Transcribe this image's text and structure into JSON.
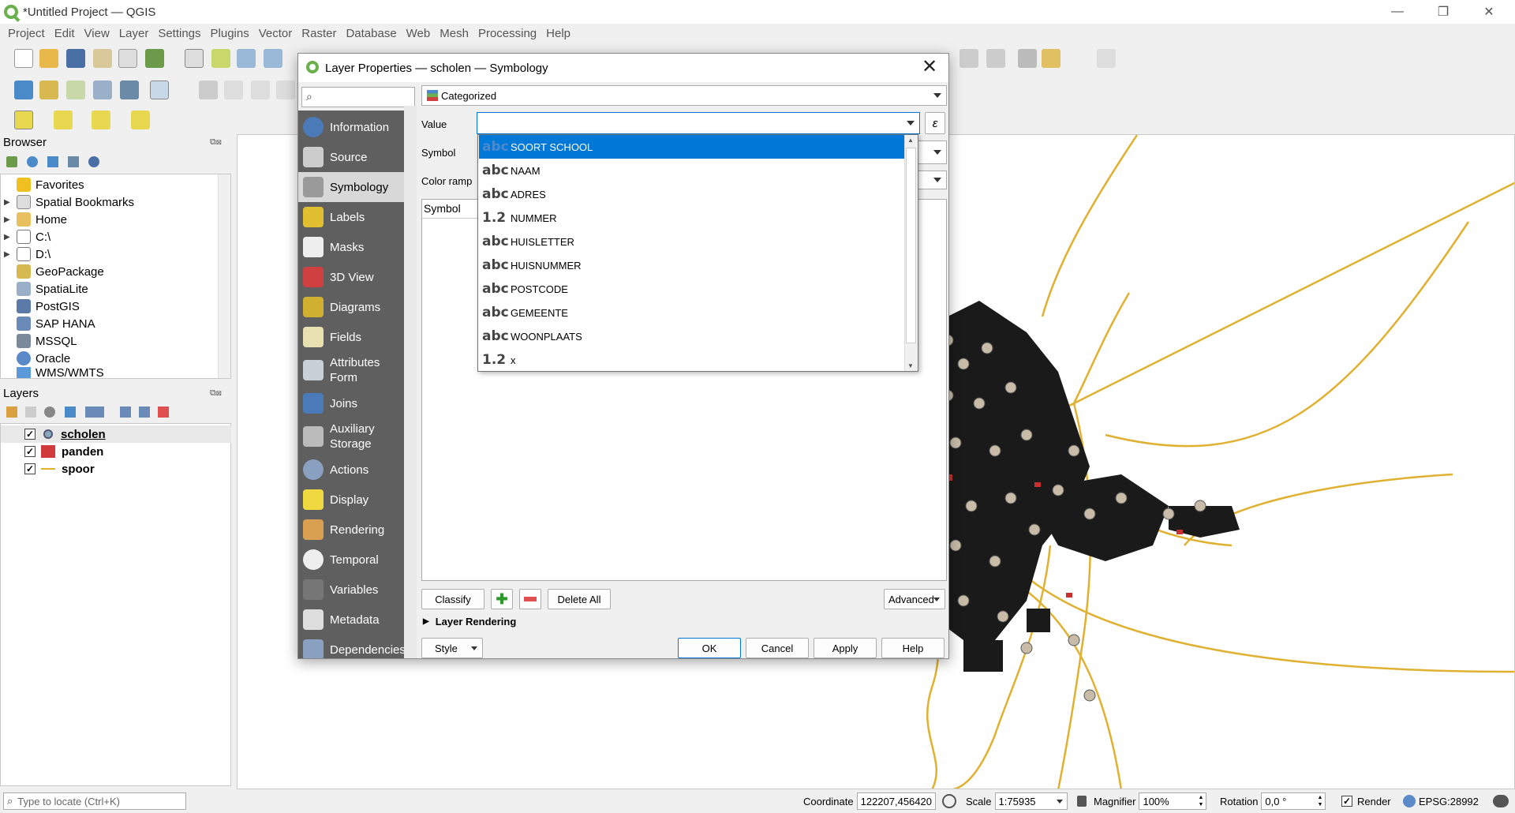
{
  "window": {
    "title": "*Untitled Project — QGIS"
  },
  "menu": [
    "Project",
    "Edit",
    "View",
    "Layer",
    "Settings",
    "Plugins",
    "Vector",
    "Raster",
    "Database",
    "Web",
    "Mesh",
    "Processing",
    "Help"
  ],
  "browser": {
    "title": "Browser",
    "items": [
      "Favorites",
      "Spatial Bookmarks",
      "Home",
      "C:\\",
      "D:\\",
      "GeoPackage",
      "SpatiaLite",
      "PostGIS",
      "SAP HANA",
      "MSSQL",
      "Oracle",
      "WMS/WMTS"
    ]
  },
  "layers": {
    "title": "Layers",
    "items": [
      {
        "name": "scholen",
        "checked": "✓"
      },
      {
        "name": "panden",
        "checked": "✓"
      },
      {
        "name": "spoor",
        "checked": "✓"
      }
    ]
  },
  "dialog": {
    "title": "Layer Properties — scholen — Symbology",
    "nav": [
      "Information",
      "Source",
      "Symbology",
      "Labels",
      "Masks",
      "3D View",
      "Diagrams",
      "Fields",
      "Attributes Form",
      "Joins",
      "Auxiliary Storage",
      "Actions",
      "Display",
      "Rendering",
      "Temporal",
      "Variables",
      "Metadata",
      "Dependencies"
    ],
    "renderer": "Categorized",
    "value_label": "Value",
    "symbol_label": "Symbol",
    "color_ramp_label": "Color ramp",
    "column_symbol": "Symbol",
    "classify": "Classify",
    "delete_all": "Delete All",
    "advanced": "Advanced",
    "layer_rendering": "Layer Rendering",
    "style": "Style",
    "ok": "OK",
    "cancel": "Cancel",
    "apply": "Apply",
    "help": "Help",
    "expression_glyph": "ε"
  },
  "field_dropdown": [
    {
      "type": "abc",
      "name": "SOORT SCHOOL"
    },
    {
      "type": "abc",
      "name": "NAAM"
    },
    {
      "type": "abc",
      "name": "ADRES"
    },
    {
      "type": "1.2",
      "name": "NUMMER"
    },
    {
      "type": "abc",
      "name": "HUISLETTER"
    },
    {
      "type": "abc",
      "name": "HUISNUMMER"
    },
    {
      "type": "abc",
      "name": "POSTCODE"
    },
    {
      "type": "abc",
      "name": "GEMEENTE"
    },
    {
      "type": "abc",
      "name": "WOONPLAATS"
    },
    {
      "type": "1.2",
      "name": "x"
    }
  ],
  "status": {
    "locate_placeholder": "Type to locate (Ctrl+K)",
    "coordinate_label": "Coordinate",
    "coordinate": "122207,456420",
    "scale_label": "Scale",
    "scale": "1:75935",
    "magnifier_label": "Magnifier",
    "magnifier": "100%",
    "rotation_label": "Rotation",
    "rotation": "0,0 °",
    "render_label": "Render",
    "crs": "EPSG:28992"
  },
  "colors": {
    "accent": "#0078d7",
    "rail": "#e0b030",
    "buildings": "#1a1a1a",
    "schools": "#c8bca8"
  }
}
